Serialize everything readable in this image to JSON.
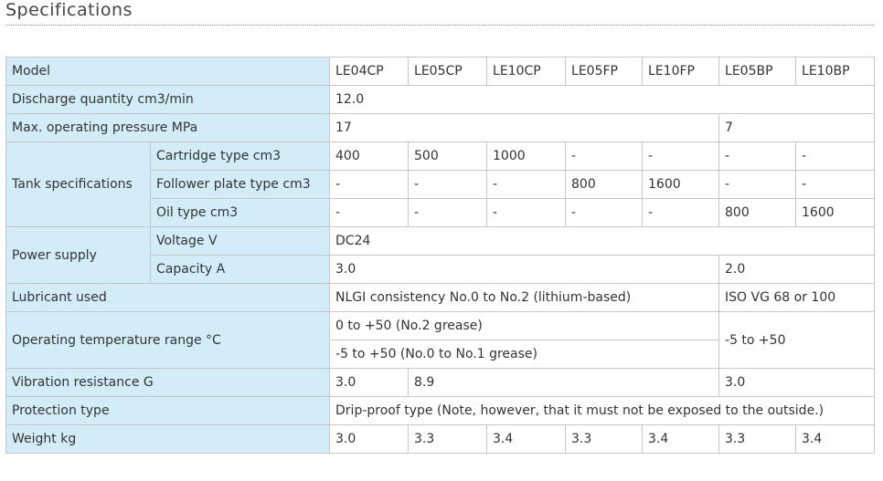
{
  "page": {
    "heading": "Specifications"
  },
  "table": {
    "model": {
      "label": "Model",
      "values": [
        "LE04CP",
        "LE05CP",
        "LE10CP",
        "LE05FP",
        "LE10FP",
        "LE05BP",
        "LE10BP"
      ]
    },
    "discharge": {
      "label": "Discharge quantity cm3/min",
      "value": "12.0"
    },
    "pressure": {
      "label": "Max. operating pressure MPa",
      "v1": "17",
      "v2": "7"
    },
    "tank": {
      "label": "Tank specifications",
      "cartridge": {
        "label": "Cartridge type cm3",
        "values": [
          "400",
          "500",
          "1000",
          "-",
          "-",
          "-",
          "-"
        ]
      },
      "follower": {
        "label": "Follower plate type cm3",
        "values": [
          "-",
          "-",
          "-",
          "800",
          "1600",
          "-",
          "-"
        ]
      },
      "oil": {
        "label": "Oil type cm3",
        "values": [
          "-",
          "-",
          "-",
          "-",
          "-",
          "800",
          "1600"
        ]
      }
    },
    "power": {
      "label": "Power supply",
      "voltage": {
        "label": "Voltage V",
        "value": "DC24"
      },
      "capacity": {
        "label": "Capacity A",
        "v1": "3.0",
        "v2": "2.0"
      }
    },
    "lubricant": {
      "label": "Lubricant used",
      "v1": "NLGI consistency No.0 to No.2 (lithium-based)",
      "v2": "ISO VG 68 or 100"
    },
    "temperature": {
      "label": "Operating temperature range °C",
      "v1a": "0 to +50 (No.2 grease)",
      "v1b": "-5 to +50 (No.0 to No.1 grease)",
      "v2": "-5 to +50"
    },
    "vibration": {
      "label": "Vibration resistance G",
      "v1": "3.0",
      "v2": "8.9",
      "v3": "3.0"
    },
    "protection": {
      "label": "Protection type",
      "value": "Drip-proof type (Note, however, that it must not be exposed to the outside.)"
    },
    "weight": {
      "label": "Weight kg",
      "values": [
        "3.0",
        "3.3",
        "3.4",
        "3.3",
        "3.4",
        "3.3",
        "3.4"
      ]
    }
  },
  "colors": {
    "label_bg": "#d3edf8",
    "border": "#c6c6c6",
    "text": "#333333"
  }
}
